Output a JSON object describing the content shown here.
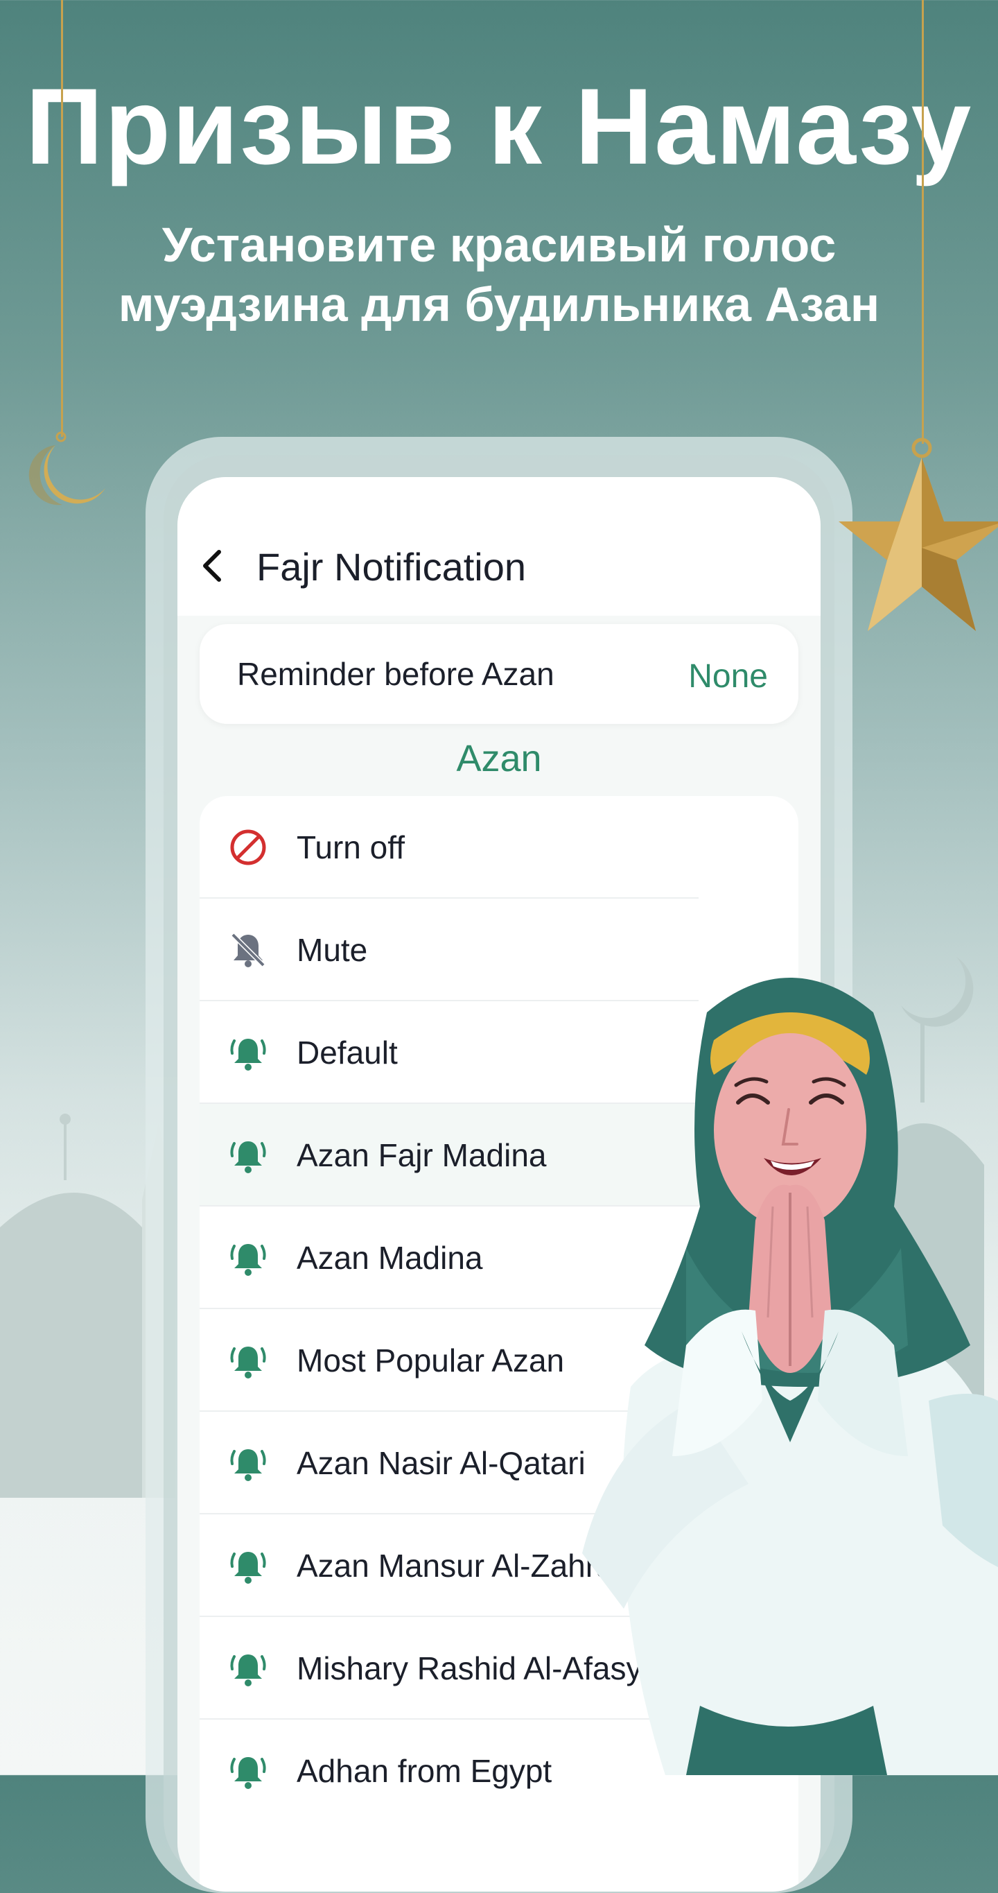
{
  "promo": {
    "headline": "Призыв к Намазу",
    "subline_line1": "Установите красивый голос",
    "subline_line2": "муэдзина для будильника Азан"
  },
  "screen": {
    "title": "Fajr Notification",
    "reminder": {
      "label": "Reminder before Azan",
      "value": "None"
    },
    "section_title": "Azan",
    "options": [
      {
        "label": "Turn off",
        "icon": "block-icon",
        "selected": false
      },
      {
        "label": "Mute",
        "icon": "bell-off-icon",
        "selected": false
      },
      {
        "label": "Default",
        "icon": "bell-ringing-icon",
        "selected": false
      },
      {
        "label": "Azan Fajr Madina",
        "icon": "bell-ringing-icon",
        "selected": true
      },
      {
        "label": "Azan Madina",
        "icon": "bell-ringing-icon",
        "selected": false
      },
      {
        "label": "Most Popular Azan",
        "icon": "bell-ringing-icon",
        "selected": false
      },
      {
        "label": "Azan Nasir Al-Qatari",
        "icon": "bell-ringing-icon",
        "selected": false
      },
      {
        "label": "Azan Mansur Al-Zahrani",
        "icon": "bell-ringing-icon",
        "selected": false
      },
      {
        "label": "Mishary Rashid Al-Afasy",
        "icon": "bell-ringing-icon",
        "selected": false
      },
      {
        "label": "Adhan from Egypt",
        "icon": "bell-ringing-icon",
        "selected": false
      }
    ]
  },
  "colors": {
    "accent": "#2f8b6a",
    "danger": "#d32f2f",
    "muted_icon": "#6b7280",
    "text": "#1b1f2a",
    "gold": "#c7a24e"
  }
}
